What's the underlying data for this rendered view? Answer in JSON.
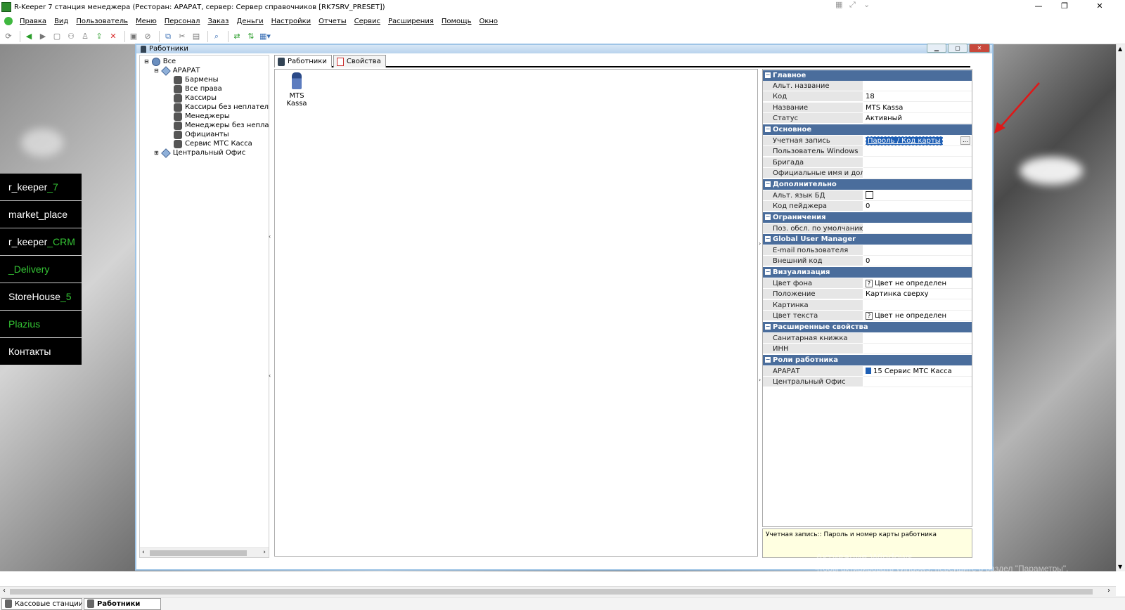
{
  "window": {
    "title": "R-Keeper 7 станция менеджера (Ресторан: АРАРАТ, сервер: Сервер справочников [RK7SRV_PRESET])",
    "min": "—",
    "restore": "❐",
    "close": "✕"
  },
  "menu": [
    "Правка",
    "Вид",
    "Пользователь",
    "Меню",
    "Персонал",
    "Заказ",
    "Деньги",
    "Настройки",
    "Отчеты",
    "Сервис",
    "Расширения",
    "Помощь",
    "Окно"
  ],
  "sidebar": [
    {
      "main": "r_keeper",
      "accent": "_7"
    },
    {
      "main": "market_place",
      "accent": ""
    },
    {
      "main": "r_keeper",
      "accent": "_CRM"
    },
    {
      "main": "",
      "accent": "_Delivery"
    },
    {
      "main": "StoreHouse",
      "accent": "_5"
    },
    {
      "main": "",
      "accent": "Plazius"
    },
    {
      "main": "Контакты",
      "accent": ""
    }
  ],
  "child_window": {
    "title": "Работники"
  },
  "tree": {
    "root": "Все",
    "restaurant": "АРАРАТ",
    "groups": [
      "Бармены",
      "Все права",
      "Кассиры",
      "Кассиры без неплательщи",
      "Менеджеры",
      "Менеджеры без неплатель",
      "Официанты",
      "Сервис МТС Касса"
    ],
    "office": "Центральный Офис"
  },
  "tabs": {
    "employees": "Работники",
    "properties": "Свойства"
  },
  "employee": {
    "name": "MTS Kassa"
  },
  "properties": {
    "sections": {
      "main": "Главное",
      "basic": "Основное",
      "extra": "Дополнительно",
      "limits": "Ограничения",
      "gum": "Global User Manager",
      "visual": "Визуализация",
      "extended": "Расширенные свойства",
      "roles": "Роли работника"
    },
    "rows": {
      "alt_name": {
        "k": "Альт. название",
        "v": ""
      },
      "code": {
        "k": "Код",
        "v": "18"
      },
      "name": {
        "k": "Название",
        "v": "MTS Kassa"
      },
      "status": {
        "k": "Статус",
        "v": "Активный"
      },
      "account": {
        "k": "Учетная запись",
        "v": "Пароль / Код карты"
      },
      "win_user": {
        "k": "Пользователь Windows",
        "v": ""
      },
      "brigade": {
        "k": "Бригада",
        "v": ""
      },
      "official": {
        "k": "Официальные имя и должнос",
        "v": ""
      },
      "alt_lang": {
        "k": "Альт. язык БД",
        "v": ""
      },
      "pager": {
        "k": "Код пейджера",
        "v": "0"
      },
      "default_area": {
        "k": "Поз. обсл. по умолчанию",
        "v": ""
      },
      "email": {
        "k": "E-mail пользователя",
        "v": ""
      },
      "ext_code": {
        "k": "Внешний код",
        "v": "0"
      },
      "bg_color": {
        "k": "Цвет фона",
        "v": "Цвет не определен"
      },
      "position": {
        "k": "Положение",
        "v": "Картинка сверху"
      },
      "picture": {
        "k": "Картинка",
        "v": ""
      },
      "text_color": {
        "k": "Цвет текста",
        "v": "Цвет не определен"
      },
      "sanitary": {
        "k": "Санитарная книжка",
        "v": ""
      },
      "inn": {
        "k": "ИНН",
        "v": ""
      },
      "role_ararat": {
        "k": "АРАРАТ",
        "v": "15 Сервис МТС Касса"
      },
      "role_office": {
        "k": "Центральный Офис",
        "v": ""
      }
    },
    "qmark": "?"
  },
  "hint": "Учетная запись:: Пароль и номер карты работника",
  "watermark": {
    "line1": "Активация Windows",
    "line2": "Чтобы активировать Windows, перейдите в раздел \"Параметры\"."
  },
  "taskbar": [
    "Кассовые станции и уд",
    "Работники"
  ],
  "colors": {
    "section_bg": "#4a6d9c",
    "accent_green": "#34c434",
    "hint_bg": "#ffffe1"
  }
}
